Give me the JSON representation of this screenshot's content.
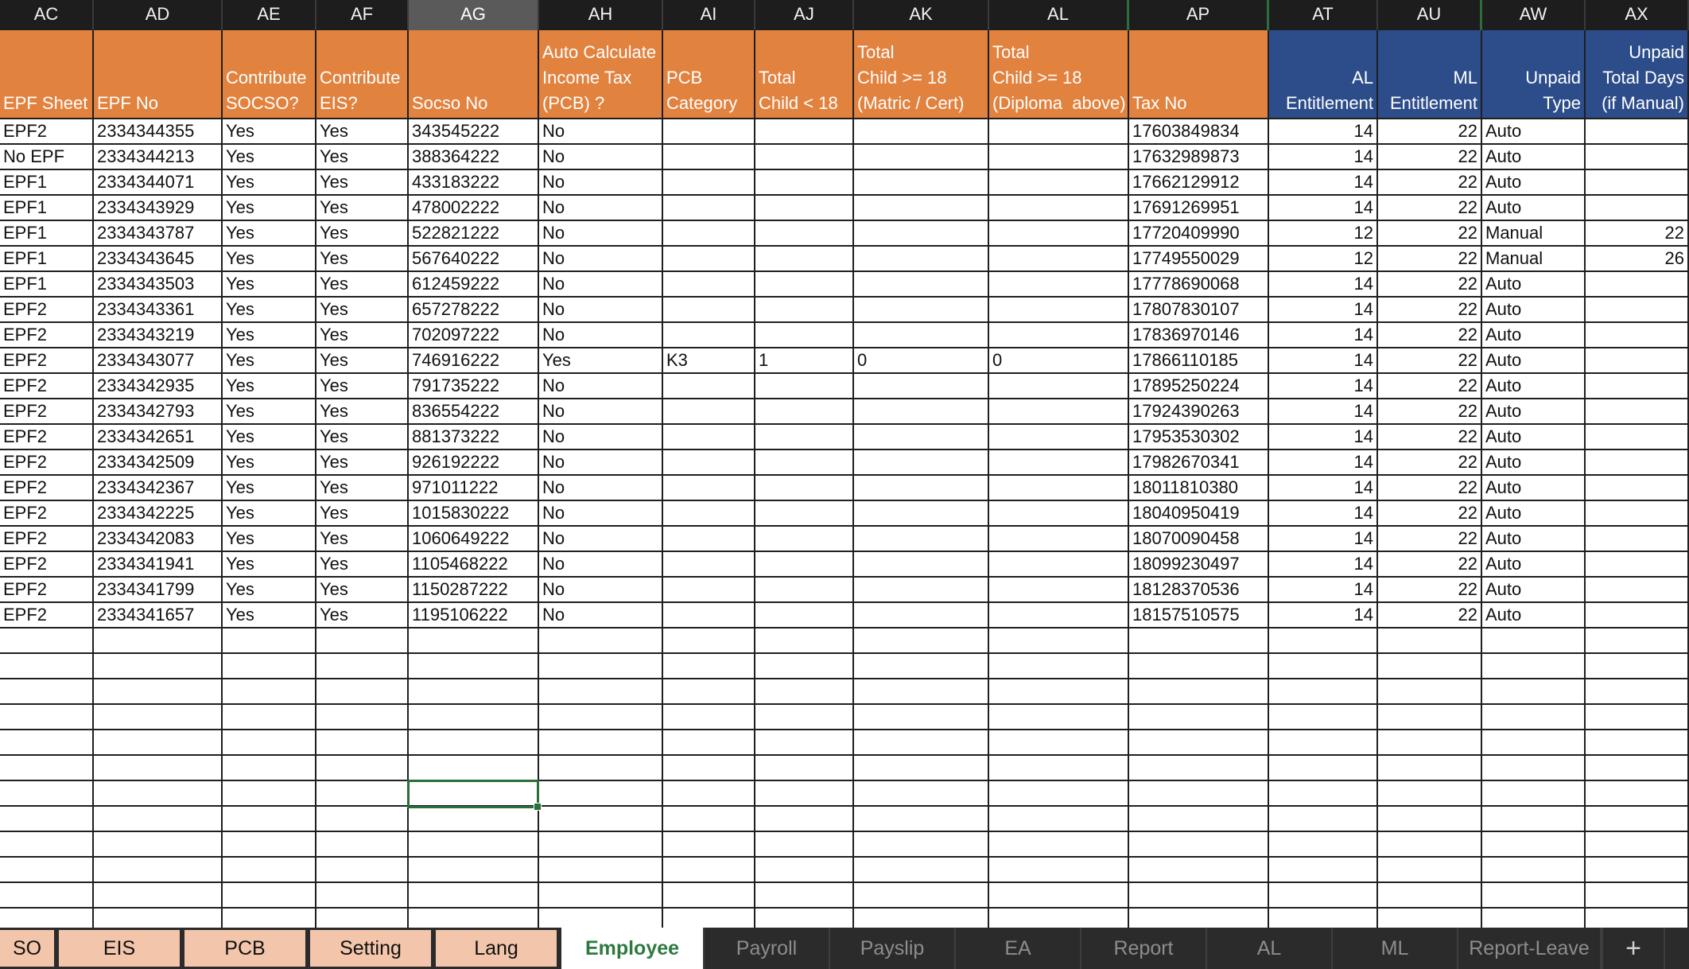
{
  "columns": [
    {
      "letter": "AC",
      "width": 118
    },
    {
      "letter": "AD",
      "width": 162
    },
    {
      "letter": "AE",
      "width": 118
    },
    {
      "letter": "AF",
      "width": 116
    },
    {
      "letter": "AG",
      "width": 164
    },
    {
      "letter": "AH",
      "width": 156
    },
    {
      "letter": "AI",
      "width": 116
    },
    {
      "letter": "AJ",
      "width": 124
    },
    {
      "letter": "AK",
      "width": 170
    },
    {
      "letter": "AL",
      "width": 176
    },
    {
      "letter": "AP",
      "width": 176
    },
    {
      "letter": "AT",
      "width": 137
    },
    {
      "letter": "AU",
      "width": 131
    },
    {
      "letter": "AW",
      "width": 130
    },
    {
      "letter": "AX",
      "width": 130
    }
  ],
  "selected_column": "AG",
  "headers": [
    {
      "text": "EPF Sheet",
      "style": "orange"
    },
    {
      "text": "EPF No",
      "style": "orange"
    },
    {
      "text": "Contribute\nSOCSO?",
      "style": "orange"
    },
    {
      "text": "Contribute\nEIS?",
      "style": "orange"
    },
    {
      "text": "Socso No",
      "style": "orange"
    },
    {
      "text": "Auto Calculate\nIncome Tax\n(PCB) ?",
      "style": "orange"
    },
    {
      "text": "PCB\nCategory",
      "style": "orange"
    },
    {
      "text": "Total\nChild < 18",
      "style": "orange"
    },
    {
      "text": "Total\nChild >= 18\n(Matric / Cert)",
      "style": "orange"
    },
    {
      "text": "Total\nChild >= 18\n(Diploma  above)",
      "style": "orange"
    },
    {
      "text": "Tax No",
      "style": "orange"
    },
    {
      "text": "AL\nEntitlement",
      "style": "blue"
    },
    {
      "text": "ML\nEntitlement",
      "style": "blue"
    },
    {
      "text": "Unpaid\nType",
      "style": "blue"
    },
    {
      "text": "Unpaid\nTotal Days\n(if Manual)",
      "style": "blue"
    }
  ],
  "rows": [
    [
      "EPF2",
      "2334344355",
      "Yes",
      "Yes",
      "343545222",
      "No",
      "",
      "",
      "",
      "",
      "17603849834",
      "14",
      "22",
      "Auto",
      ""
    ],
    [
      "No EPF",
      "2334344213",
      "Yes",
      "Yes",
      "388364222",
      "No",
      "",
      "",
      "",
      "",
      "17632989873",
      "14",
      "22",
      "Auto",
      ""
    ],
    [
      "EPF1",
      "2334344071",
      "Yes",
      "Yes",
      "433183222",
      "No",
      "",
      "",
      "",
      "",
      "17662129912",
      "14",
      "22",
      "Auto",
      ""
    ],
    [
      "EPF1",
      "2334343929",
      "Yes",
      "Yes",
      "478002222",
      "No",
      "",
      "",
      "",
      "",
      "17691269951",
      "14",
      "22",
      "Auto",
      ""
    ],
    [
      "EPF1",
      "2334343787",
      "Yes",
      "Yes",
      "522821222",
      "No",
      "",
      "",
      "",
      "",
      "17720409990",
      "12",
      "22",
      "Manual",
      "22"
    ],
    [
      "EPF1",
      "2334343645",
      "Yes",
      "Yes",
      "567640222",
      "No",
      "",
      "",
      "",
      "",
      "17749550029",
      "12",
      "22",
      "Manual",
      "26"
    ],
    [
      "EPF1",
      "2334343503",
      "Yes",
      "Yes",
      "612459222",
      "No",
      "",
      "",
      "",
      "",
      "17778690068",
      "14",
      "22",
      "Auto",
      ""
    ],
    [
      "EPF2",
      "2334343361",
      "Yes",
      "Yes",
      "657278222",
      "No",
      "",
      "",
      "",
      "",
      "17807830107",
      "14",
      "22",
      "Auto",
      ""
    ],
    [
      "EPF2",
      "2334343219",
      "Yes",
      "Yes",
      "702097222",
      "No",
      "",
      "",
      "",
      "",
      "17836970146",
      "14",
      "22",
      "Auto",
      ""
    ],
    [
      "EPF2",
      "2334343077",
      "Yes",
      "Yes",
      "746916222",
      "Yes",
      "K3",
      "1",
      "0",
      "0",
      "17866110185",
      "14",
      "22",
      "Auto",
      ""
    ],
    [
      "EPF2",
      "2334342935",
      "Yes",
      "Yes",
      "791735222",
      "No",
      "",
      "",
      "",
      "",
      "17895250224",
      "14",
      "22",
      "Auto",
      ""
    ],
    [
      "EPF2",
      "2334342793",
      "Yes",
      "Yes",
      "836554222",
      "No",
      "",
      "",
      "",
      "",
      "17924390263",
      "14",
      "22",
      "Auto",
      ""
    ],
    [
      "EPF2",
      "2334342651",
      "Yes",
      "Yes",
      "881373222",
      "No",
      "",
      "",
      "",
      "",
      "17953530302",
      "14",
      "22",
      "Auto",
      ""
    ],
    [
      "EPF2",
      "2334342509",
      "Yes",
      "Yes",
      "926192222",
      "No",
      "",
      "",
      "",
      "",
      "17982670341",
      "14",
      "22",
      "Auto",
      ""
    ],
    [
      "EPF2",
      "2334342367",
      "Yes",
      "Yes",
      "971011222",
      "No",
      "",
      "",
      "",
      "",
      "18011810380",
      "14",
      "22",
      "Auto",
      ""
    ],
    [
      "EPF2",
      "2334342225",
      "Yes",
      "Yes",
      "1015830222",
      "No",
      "",
      "",
      "",
      "",
      "18040950419",
      "14",
      "22",
      "Auto",
      ""
    ],
    [
      "EPF2",
      "2334342083",
      "Yes",
      "Yes",
      "1060649222",
      "No",
      "",
      "",
      "",
      "",
      "18070090458",
      "14",
      "22",
      "Auto",
      ""
    ],
    [
      "EPF2",
      "2334341941",
      "Yes",
      "Yes",
      "1105468222",
      "No",
      "",
      "",
      "",
      "",
      "18099230497",
      "14",
      "22",
      "Auto",
      ""
    ],
    [
      "EPF2",
      "2334341799",
      "Yes",
      "Yes",
      "1150287222",
      "No",
      "",
      "",
      "",
      "",
      "18128370536",
      "14",
      "22",
      "Auto",
      ""
    ],
    [
      "EPF2",
      "2334341657",
      "Yes",
      "Yes",
      "1195106222",
      "No",
      "",
      "",
      "",
      "",
      "18157510575",
      "14",
      "22",
      "Auto",
      ""
    ]
  ],
  "numeric_columns": [
    11,
    12,
    14
  ],
  "empty_row_count": 12,
  "selected_cell": {
    "column": "AG",
    "empty_row_index": 6
  },
  "colors": {
    "header_orange": "#e2823f",
    "header_blue": "#2c4d8a",
    "selection_green": "#2a6e3a",
    "tab_peach": "#f3c6ab",
    "active_tab_text": "#2b7a3e"
  },
  "tabs": [
    {
      "label": "SO",
      "style": "colored",
      "width": 68
    },
    {
      "label": "EIS",
      "style": "colored",
      "width": 152
    },
    {
      "label": "PCB",
      "style": "colored",
      "width": 152
    },
    {
      "label": "Setting",
      "style": "colored",
      "width": 152
    },
    {
      "label": "Lang",
      "style": "colored",
      "width": 152
    },
    {
      "label": "Employee",
      "style": "active",
      "width": 180
    },
    {
      "label": "Payroll",
      "style": "plain",
      "width": 158
    },
    {
      "label": "Payslip",
      "style": "plain",
      "width": 158
    },
    {
      "label": "EA",
      "style": "plain",
      "width": 158
    },
    {
      "label": "Report",
      "style": "plain",
      "width": 158
    },
    {
      "label": "AL",
      "style": "plain",
      "width": 158
    },
    {
      "label": "ML",
      "style": "plain",
      "width": 158
    },
    {
      "label": "Report-Leave",
      "style": "plain",
      "width": 180
    },
    {
      "label": "+",
      "style": "plus",
      "width": 80
    }
  ]
}
